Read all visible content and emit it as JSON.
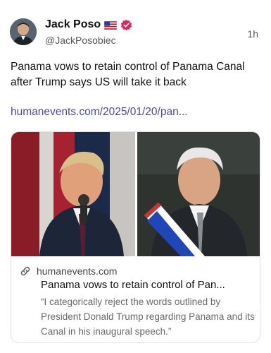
{
  "author": {
    "display_name": "Jack Poso",
    "handle": "@JackPosobiec",
    "avatar_icon": "profile-photo",
    "flag_icon": "us-flag-icon",
    "verified_icon": "verified-badge-icon",
    "verified_color": "#e0245e"
  },
  "post": {
    "timestamp": "1h",
    "text": "Panama vows to retain control of Panama Canal after Trump says US will take it back",
    "link_text": "humanevents.com/2025/01/20/pan...",
    "link_color": "#4a4aa8"
  },
  "card": {
    "domain_icon": "link-icon",
    "domain": "humanevents.com",
    "title": "Panama vows to retain control of Pan...",
    "quote": "“I categorically reject the words outlined by President Donald Trump regarding Panama and its Canal in his inaugural speech.”",
    "left_image": "photo-donald-trump",
    "right_image": "photo-panama-president"
  }
}
